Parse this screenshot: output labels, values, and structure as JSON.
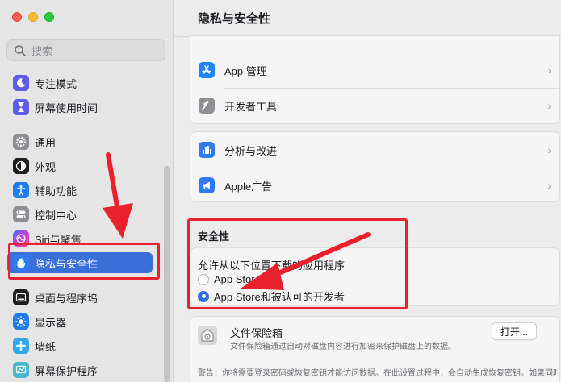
{
  "window": {
    "title": "隐私与安全性"
  },
  "sidebar": {
    "search_placeholder": "搜索",
    "items": [
      {
        "label": "专注模式",
        "icon": "moon-icon",
        "color": "#5e5ce6"
      },
      {
        "label": "屏幕使用时间",
        "icon": "hourglass-icon",
        "color": "#5e5ce6"
      },
      {
        "label": "通用",
        "icon": "gear-icon",
        "color": "#8e8e93"
      },
      {
        "label": "外观",
        "icon": "appearance-icon",
        "color": "#1d1d1f"
      },
      {
        "label": "辅助功能",
        "icon": "accessibility-icon",
        "color": "#1e7cf2"
      },
      {
        "label": "控制中心",
        "icon": "control-center-icon",
        "color": "#8e8e93"
      },
      {
        "label": "Siri与聚焦",
        "icon": "siri-icon",
        "color": "#c73ae0"
      },
      {
        "label": "隐私与安全性",
        "icon": "hand-icon",
        "color": "#2f7af5"
      },
      {
        "label": "桌面与程序坞",
        "icon": "dock-icon",
        "color": "#1d1d1f"
      },
      {
        "label": "显示器",
        "icon": "sun-icon",
        "color": "#1e7cf2"
      },
      {
        "label": "墙纸",
        "icon": "wallpaper-icon",
        "color": "#35a7e8"
      },
      {
        "label": "屏幕保护程序",
        "icon": "screensaver-icon",
        "color": "#48b8d0"
      }
    ],
    "active_index": 7
  },
  "main": {
    "group1": [
      {
        "label": "App 管理",
        "icon": "app-store-icon"
      },
      {
        "label": "开发者工具",
        "icon": "hammer-icon"
      }
    ],
    "group2": [
      {
        "label": "分析与改进",
        "icon": "chart-icon"
      },
      {
        "label": "Apple广告",
        "icon": "megaphone-icon"
      }
    ],
    "security": {
      "title": "安全性",
      "allow_label": "允许从以下位置下载的应用程序",
      "options": [
        {
          "label": "App Store",
          "selected": false
        },
        {
          "label": "App Store和被认可的开发者",
          "selected": true
        }
      ]
    },
    "filevault": {
      "title": "文件保险箱",
      "description": "文件保险箱通过自动对磁盘内容进行加密来保护磁盘上的数据。",
      "button": "打开...",
      "warning": "警告：你将需要登录密码或恢复密钥才能访问数据。在此设置过程中，会自动生成恢复密钥。如果同时忘记密码和恢复密钥，数据将会丢失。"
    }
  },
  "colors": {
    "accent": "#3a6fd8",
    "annotation_red": "#e8212d"
  }
}
